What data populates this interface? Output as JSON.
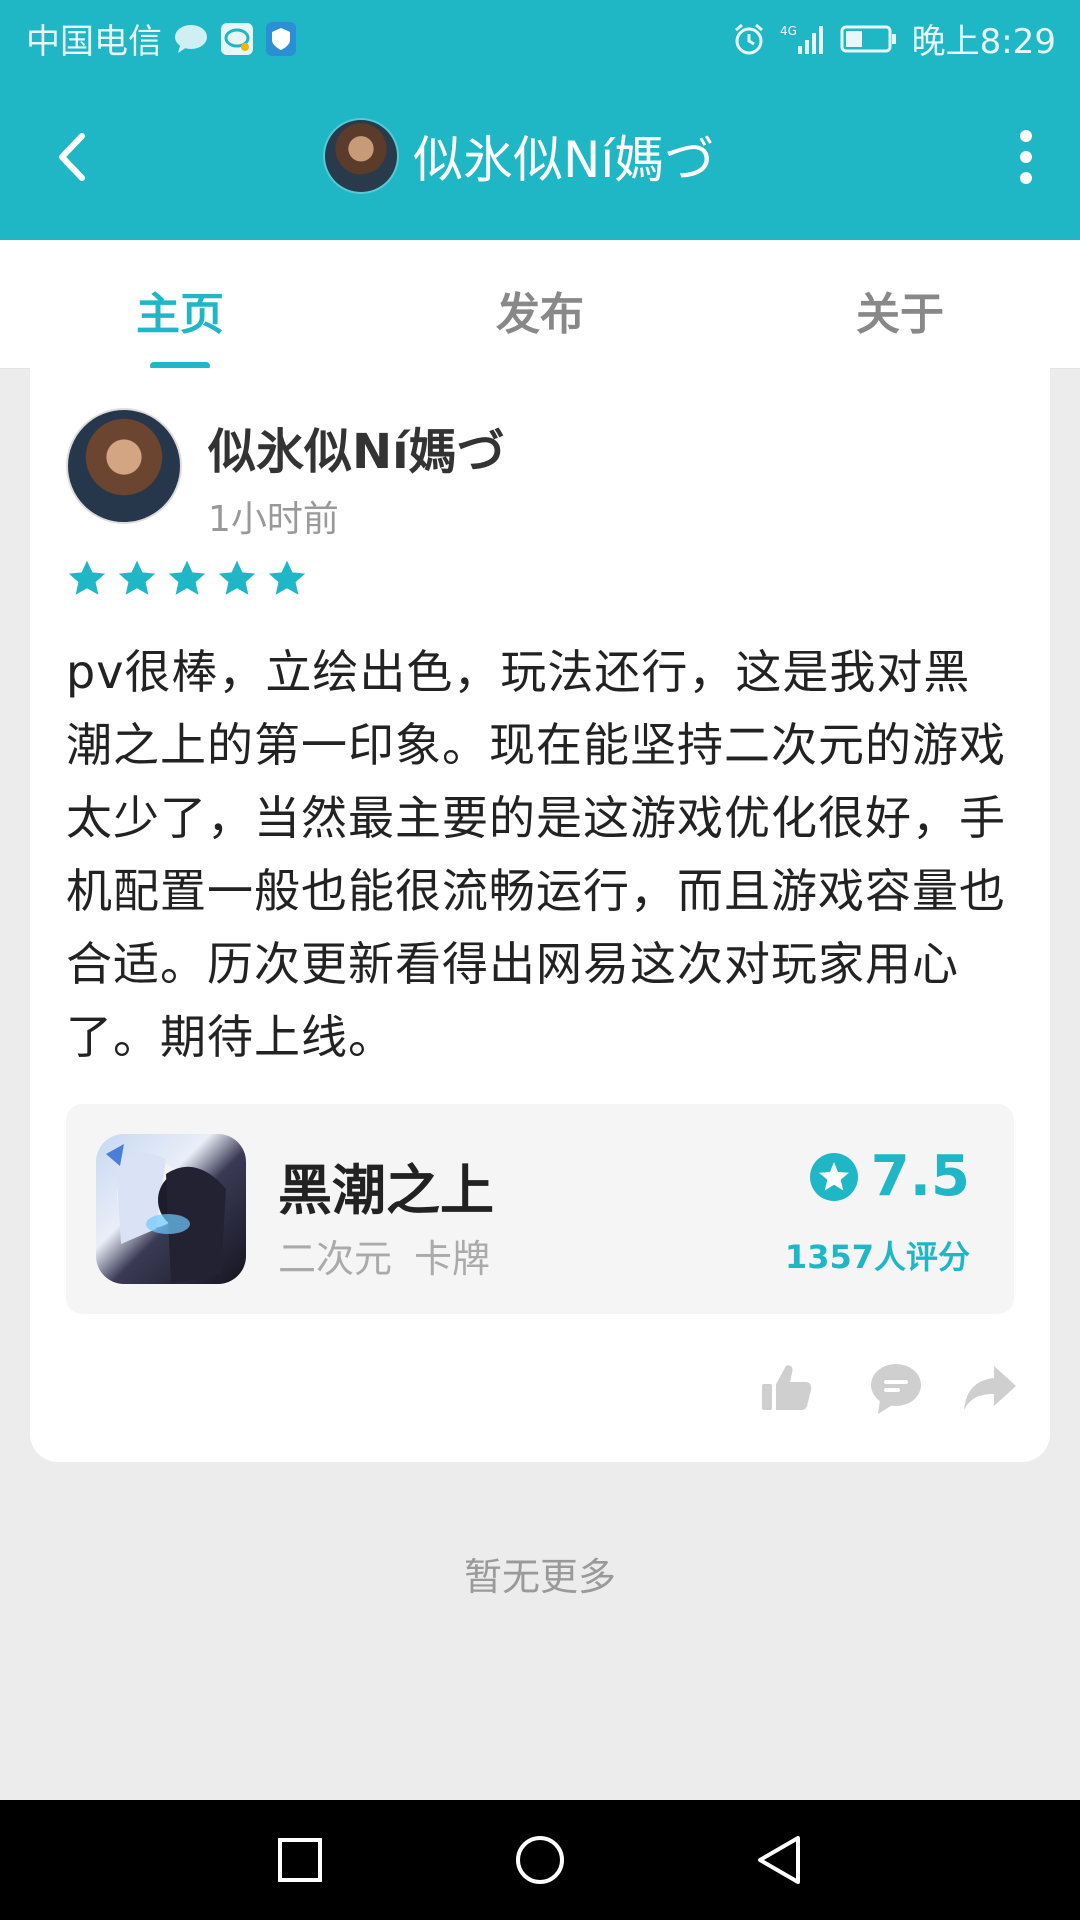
{
  "status_bar": {
    "carrier": "中国电信",
    "network": "4G",
    "time": "晚上8:29",
    "icons": [
      "chat-bubble-icon",
      "message-app-icon",
      "shield-icon",
      "alarm-icon",
      "signal-icon",
      "battery-icon"
    ]
  },
  "header": {
    "title": "似氷似Ní媽づ",
    "back_icon": "back-arrow-icon",
    "menu_icon": "more-vert-icon"
  },
  "tabs": [
    {
      "label": "主页",
      "active": true
    },
    {
      "label": "发布",
      "active": false
    },
    {
      "label": "关于",
      "active": false
    }
  ],
  "post": {
    "author": "似氷似Ní媽づ",
    "time": "1小时前",
    "stars": 5,
    "text": "pv很棒，立绘出色，玩法还行，这是我对黑潮之上的第一印象。现在能坚持二次元的游戏太少了，当然最主要的是这游戏优化很好，手机配置一般也能很流畅运行，而且游戏容量也合适。历次更新看得出网易这次对玩家用心了。期待上线。",
    "game": {
      "name": "黑潮之上",
      "tags": [
        "二次元",
        "卡牌"
      ],
      "rating": "7.5",
      "rating_count": "1357人评分"
    },
    "actions": [
      "like-icon",
      "comment-icon",
      "share-icon"
    ]
  },
  "footer_text": "暂无更多",
  "colors": {
    "accent": "#1fb7c6",
    "background": "#ececec",
    "card": "#ffffff",
    "text": "#222222",
    "muted": "#999999"
  }
}
